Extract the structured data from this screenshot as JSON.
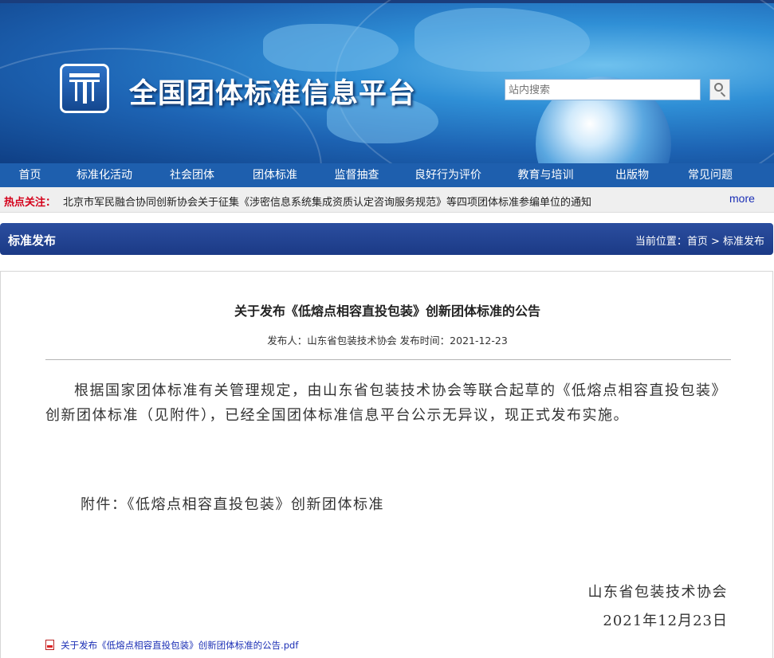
{
  "header": {
    "site_title": "全国团体标准信息平台",
    "search_placeholder": "站内搜索"
  },
  "nav": {
    "items": [
      "首页",
      "标准化活动",
      "社会团体",
      "团体标准",
      "监督抽查",
      "良好行为评价",
      "教育与培训",
      "出版物",
      "常见问题"
    ]
  },
  "hot": {
    "label": "热点关注：",
    "text": "北京市军民融合协同创新协会关于征集《涉密信息系统集成资质认定咨询服务规范》等四项团体标准参编单位的通知",
    "more": "more"
  },
  "section": {
    "title": "标准发布",
    "breadcrumb": "当前位置：首页 > 标准发布"
  },
  "article": {
    "title": "关于发布《低熔点相容直投包装》创新团体标准的公告",
    "meta": "发布人：山东省包装技术协会   发布时间：2021-12-23",
    "body": "根据国家团体标准有关管理规定，由山东省包装技术协会等联合起草的《低熔点相容直投包装》创新团体标准（见附件），已经全国团体标准信息平台公示无异议，现正式发布实施。",
    "attachment_line": "附件：《低熔点相容直投包装》创新团体标准",
    "signature_org": "山东省包装技术协会",
    "signature_date": "2021年12月23日",
    "pdf_link": "关于发布《低熔点相容直投包装》创新团体标准的公告.pdf"
  },
  "colors": {
    "nav_bg": "#1e5fae",
    "section_bg": "#2b4e9f",
    "hot_label": "#d4001a",
    "link": "#1b2fb5"
  }
}
